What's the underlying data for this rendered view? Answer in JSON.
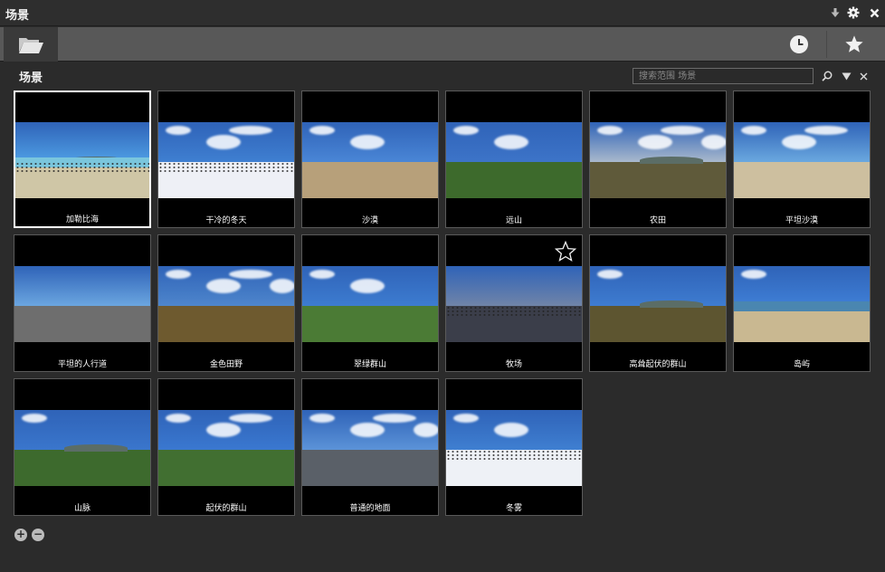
{
  "window": {
    "title": "场景"
  },
  "toolbar": {
    "folder_icon": "folder-open-icon",
    "recent_icon": "clock-icon",
    "favorites_icon": "star-icon"
  },
  "section": {
    "title": "场景"
  },
  "search": {
    "placeholder": "搜索范围 场景"
  },
  "tiles": [
    {
      "label": "加勒比海",
      "sky": "#4f9fe5",
      "ground": "#cfc6a6",
      "selected": true,
      "clouds": 0,
      "hills": true,
      "water": "#7ac6dd",
      "dots": true
    },
    {
      "label": "干冷的冬天",
      "sky": "#3f7fd1",
      "ground": "#eef0f6",
      "clouds": 3,
      "dots": true
    },
    {
      "label": "沙漠",
      "sky": "#4a86d6",
      "ground": "#b7a07a",
      "clouds": 2
    },
    {
      "label": "远山",
      "sky": "#3d74c8",
      "ground": "#3d6a2c",
      "clouds": 2
    },
    {
      "label": "农田",
      "sky": "#a9b9cc",
      "ground": "#5f5a3a",
      "clouds": 4,
      "hills": true
    },
    {
      "label": "平坦沙漠",
      "sky": "#6aa8df",
      "ground": "#cdbf9f",
      "clouds": 3
    },
    {
      "label": "平坦的人行道",
      "sky": "#6ba6e0",
      "ground": "#6e6e6e",
      "clouds": 0
    },
    {
      "label": "金色田野",
      "sky": "#4e86cc",
      "ground": "#6e5a2f",
      "clouds": 4
    },
    {
      "label": "翠绿群山",
      "sky": "#3d7cd0",
      "ground": "#4b7b35",
      "clouds": 2
    },
    {
      "label": "牧场",
      "sky": "#7084a8",
      "ground": "#3b3e4a",
      "clouds": 0,
      "dots": true,
      "favorite": true
    },
    {
      "label": "高耸起伏的群山",
      "sky": "#3e7cd0",
      "ground": "#5d5530",
      "clouds": 1,
      "hills": true
    },
    {
      "label": "岛屿",
      "sky": "#3f7fd6",
      "ground": "#c9b891",
      "clouds": 1,
      "water": "#4a86b0"
    },
    {
      "label": "山脉",
      "sky": "#3a76cc",
      "ground": "#3d6a2d",
      "clouds": 1,
      "hills": true
    },
    {
      "label": "起伏的群山",
      "sky": "#3a78d0",
      "ground": "#416f31",
      "clouds": 3
    },
    {
      "label": "普通的地面",
      "sky": "#5b93d8",
      "ground": "#5a6068",
      "clouds": 4
    },
    {
      "label": "冬雾",
      "sky": "#3f7fd1",
      "ground": "#eef1f6",
      "clouds": 2,
      "dots": true
    }
  ],
  "zoom": {
    "in_label": "+",
    "out_label": "−"
  }
}
